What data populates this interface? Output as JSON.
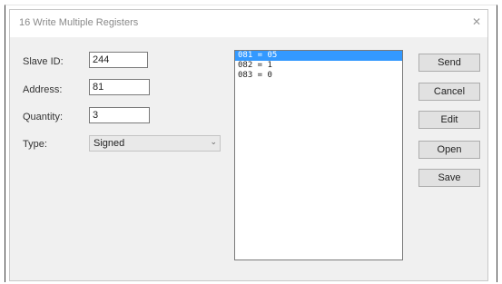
{
  "window": {
    "title": "16 Write Multiple Registers",
    "close_glyph": "✕"
  },
  "form": {
    "slave_id": {
      "label": "Slave ID:",
      "value": "244"
    },
    "address": {
      "label": "Address:",
      "value": "81"
    },
    "quantity": {
      "label": "Quantity:",
      "value": "3"
    },
    "type": {
      "label": "Type:",
      "value": "Signed"
    }
  },
  "register_list": [
    {
      "text": "081 = 05",
      "selected": true
    },
    {
      "text": "082 = 1",
      "selected": false
    },
    {
      "text": "083 = 0",
      "selected": false
    }
  ],
  "buttons": {
    "send": "Send",
    "cancel": "Cancel",
    "edit": "Edit",
    "open": "Open",
    "save": "Save"
  },
  "colors": {
    "selection": "#3399ff",
    "window_bg": "#f0f0f0"
  }
}
